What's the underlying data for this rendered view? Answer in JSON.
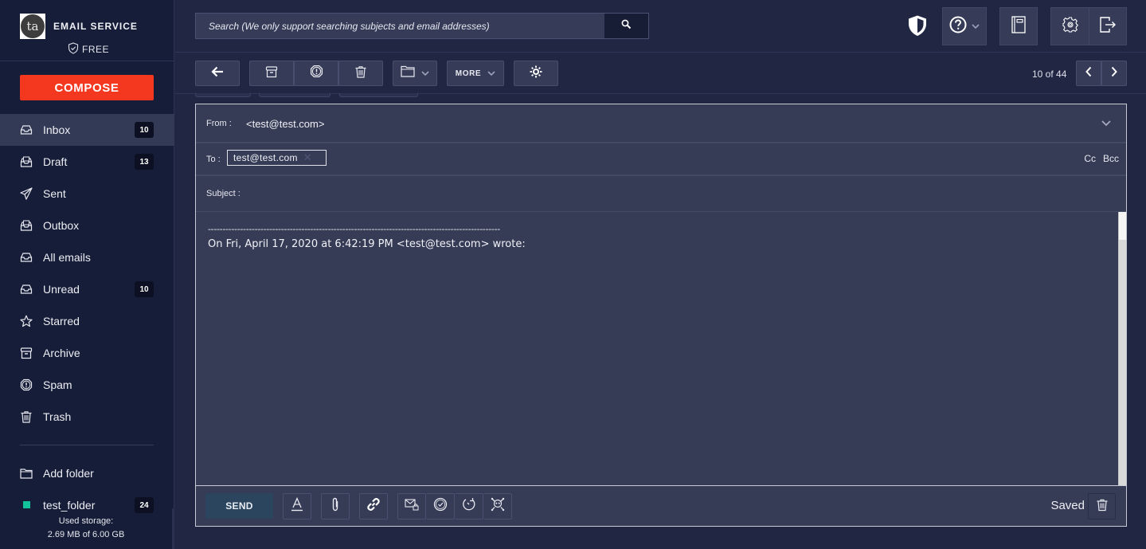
{
  "brand": {
    "title": "EMAIL SERVICE",
    "plan": "FREE",
    "logo_text": "ta"
  },
  "sidebar": {
    "compose_label": "COMPOSE",
    "items": [
      {
        "label": "Inbox",
        "icon": "inbox-icon",
        "badge": "10",
        "active": true
      },
      {
        "label": "Draft",
        "icon": "draft-icon",
        "badge": "13"
      },
      {
        "label": "Sent",
        "icon": "paper-plane-icon"
      },
      {
        "label": "Outbox",
        "icon": "outbox-icon"
      },
      {
        "label": "All emails",
        "icon": "all-emails-icon"
      },
      {
        "label": "Unread",
        "icon": "unread-icon",
        "badge": "10"
      },
      {
        "label": "Starred",
        "icon": "star-icon"
      },
      {
        "label": "Archive",
        "icon": "archive-icon"
      },
      {
        "label": "Spam",
        "icon": "spam-icon"
      },
      {
        "label": "Trash",
        "icon": "trash-icon"
      }
    ],
    "add_folder_label": "Add folder",
    "folders": [
      {
        "label": "test_folder",
        "badge": "24",
        "color": "#12c29b"
      }
    ],
    "storage_label": "Used storage:",
    "storage_value": "2.69 MB of 6.00 GB"
  },
  "search": {
    "placeholder": "Search (We only support searching subjects and email addresses)",
    "value": ""
  },
  "toolbar": {
    "more_label": "MORE",
    "counter": "10 of 44"
  },
  "composer": {
    "from_label": "From :",
    "from_value": "<test@test.com>",
    "to_label": "To :",
    "to_recipients": [
      "test@test.com"
    ],
    "cc_label": "Cc",
    "bcc_label": "Bcc",
    "subject_label": "Subject :",
    "subject_value": "",
    "body_separator": "----------------------------------------------------------------------------------------------------",
    "body_quote_header": "On Fri, April 17, 2020 at 6:42:19 PM <test@test.com> wrote:",
    "send_label": "SEND",
    "status": "Saved"
  },
  "colors": {
    "accent": "#f4371f",
    "sidebar_bg": "#161d38",
    "main_bg": "#212643",
    "panel_bg": "#363c56",
    "send_bg": "#2c455e",
    "folder_color": "#12c29b"
  }
}
